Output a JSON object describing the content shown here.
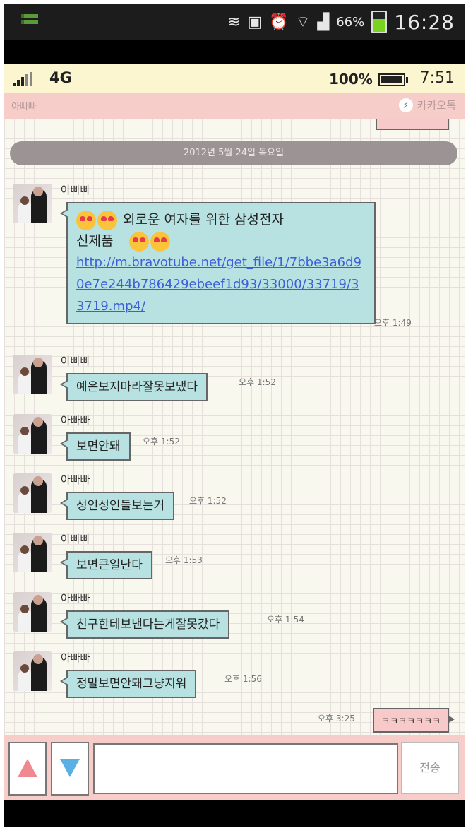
{
  "status_bar": {
    "battery": "66%",
    "time": "16:28"
  },
  "phone_bar": {
    "network": "4G",
    "battery": "100%",
    "time": "7:51"
  },
  "header": {
    "title": "아빠빠",
    "brand": "카카오톡"
  },
  "date_divider": "2012년 5월 24일 목요일",
  "messages": [
    {
      "sender": "아빠빠",
      "text_line1": "외로운 여자를 위한 삼성전자",
      "text_line2": "신제품",
      "link": "http://m.bravotube.net/get_file/1/7bbe3a6d90e7e244b786429ebeef1d93/33000/33719/33719.mp4/",
      "time": "오후 1:49"
    },
    {
      "sender": "아빠빠",
      "text": "예은보지마라잘못보냈다",
      "time": "오후 1:52"
    },
    {
      "sender": "아빠빠",
      "text": "보면안돼",
      "time": "오후 1:52"
    },
    {
      "sender": "아빠빠",
      "text": "성인성인들보는거",
      "time": "오후 1:52"
    },
    {
      "sender": "아빠빠",
      "text": "보면큰일난다",
      "time": "오후 1:53"
    },
    {
      "sender": "아빠빠",
      "text": "친구한테보낸다는게잘못갔다",
      "time": "오후 1:54"
    },
    {
      "sender": "아빠빠",
      "text": "정말보면안돼그냥지워",
      "time": "오후 1:56"
    }
  ],
  "my_message": {
    "text": "ㅋㅋㅋㅋㅋㅋㅋ",
    "time": "오후 3:25"
  },
  "input_bar": {
    "send_label": "전송"
  }
}
